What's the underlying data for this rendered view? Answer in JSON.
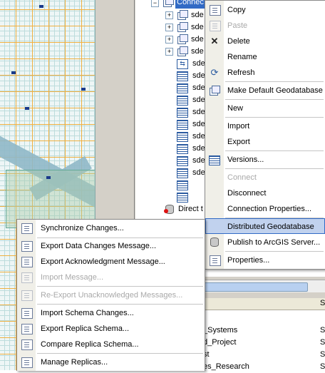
{
  "tree": {
    "selected_label": "Connec",
    "rows": [
      "sde",
      "sde",
      "sde",
      "sde",
      "sde",
      "sde",
      "sde",
      "sde",
      "sde",
      "sde",
      "sde",
      "sde",
      "sde",
      "sde"
    ],
    "direct_label": "Direct t"
  },
  "catalog_menu": {
    "items": [
      {
        "label": "Copy",
        "icon": "copy-icon",
        "disabled": false
      },
      {
        "label": "Paste",
        "icon": "paste-icon",
        "disabled": true
      },
      {
        "label": "Delete",
        "icon": "delete-icon",
        "disabled": false
      },
      {
        "label": "Rename",
        "icon": "",
        "disabled": false
      },
      {
        "label": "Refresh",
        "icon": "refresh-icon",
        "disabled": false
      },
      {
        "label": "Make Default Geodatabase",
        "icon": "default-geodatabase-icon",
        "disabled": false
      },
      {
        "label": "New",
        "icon": "",
        "disabled": false
      },
      {
        "label": "Import",
        "icon": "",
        "disabled": false
      },
      {
        "label": "Export",
        "icon": "",
        "disabled": false
      },
      {
        "label": "Versions...",
        "icon": "versions-icon",
        "disabled": false
      },
      {
        "label": "Connect",
        "icon": "",
        "disabled": true
      },
      {
        "label": "Disconnect",
        "icon": "",
        "disabled": false
      },
      {
        "label": "Connection Properties...",
        "icon": "",
        "disabled": false
      },
      {
        "label": "Distributed Geodatabase",
        "icon": "",
        "disabled": false,
        "highlighted": true
      },
      {
        "label": "Publish to ArcGIS Server...",
        "icon": "publish-server-icon",
        "disabled": false
      },
      {
        "label": "Properties...",
        "icon": "properties-icon",
        "disabled": false
      }
    ]
  },
  "distributed_menu": {
    "items": [
      {
        "label": "Synchronize Changes...",
        "icon": "synchronize-icon",
        "disabled": false
      },
      {
        "label": "Export Data Changes Message...",
        "icon": "export-data-changes-icon",
        "disabled": false
      },
      {
        "label": "Export Acknowledgment Message...",
        "icon": "export-acknowledgment-icon",
        "disabled": false
      },
      {
        "label": "Import Message...",
        "icon": "import-message-icon",
        "disabled": true
      },
      {
        "label": "Re-Export Unacknowledged Messages...",
        "icon": "reexport-icon",
        "disabled": true
      },
      {
        "label": "Import Schema Changes...",
        "icon": "import-schema-icon",
        "disabled": false
      },
      {
        "label": "Export Replica Schema...",
        "icon": "export-replica-schema-icon",
        "disabled": false
      },
      {
        "label": "Compare Replica Schema...",
        "icon": "compare-replica-schema-icon",
        "disabled": false
      },
      {
        "label": "Manage Replicas...",
        "icon": "manage-replicas-icon",
        "disabled": false
      }
    ]
  },
  "list": {
    "rows": [
      {
        "name": "_Systems",
        "type": "S"
      },
      {
        "name": "d_Project",
        "type": "S"
      },
      {
        "name": "st",
        "type": "S"
      },
      {
        "name": "es_Research",
        "type": "S"
      }
    ],
    "header_first": "",
    "header_second": "S"
  }
}
